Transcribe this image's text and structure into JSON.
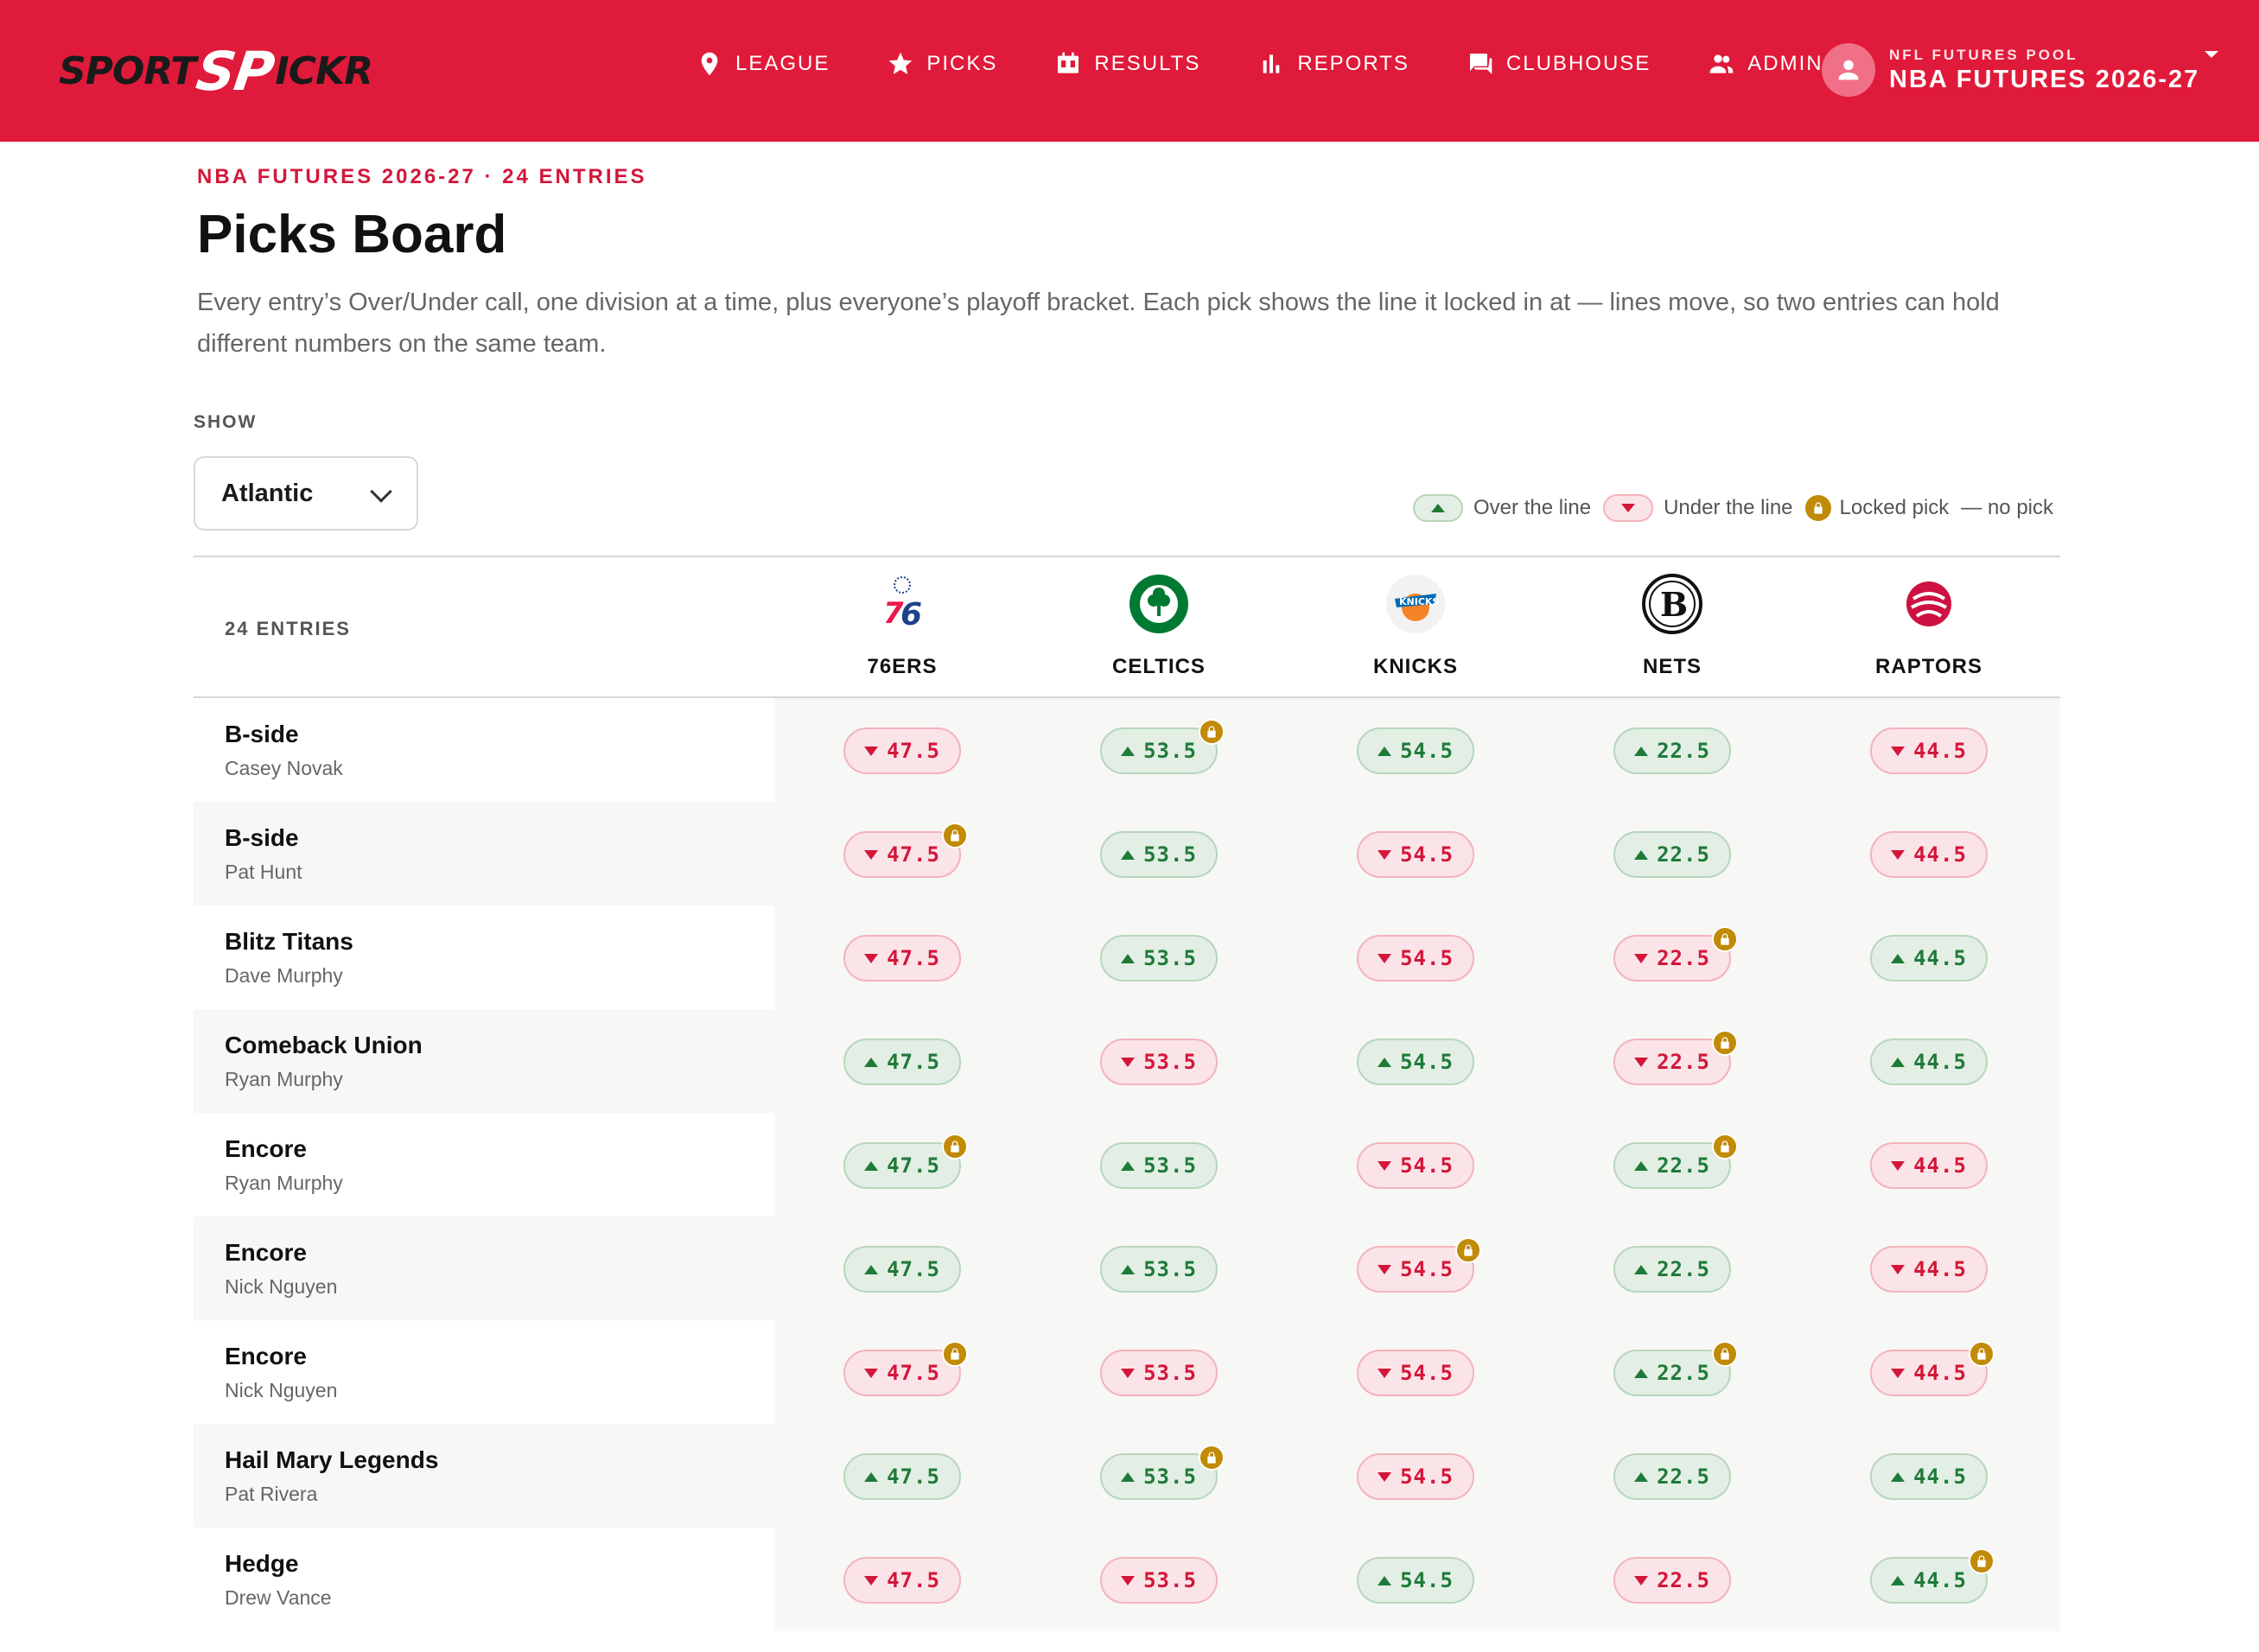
{
  "brand": {
    "logo_left": "SPORT",
    "logo_mid": "SP",
    "logo_right": "ICKR"
  },
  "nav": [
    {
      "label": "LEAGUE",
      "icon": "map-pin-icon"
    },
    {
      "label": "PICKS",
      "icon": "star-icon"
    },
    {
      "label": "RESULTS",
      "icon": "scoreboard-icon"
    },
    {
      "label": "REPORTS",
      "icon": "bar-chart-icon"
    },
    {
      "label": "CLUBHOUSE",
      "icon": "chat-icon"
    },
    {
      "label": "ADMIN",
      "icon": "people-icon"
    }
  ],
  "pool": {
    "label": "NFL FUTURES POOL",
    "value": "NBA FUTURES 2026-27"
  },
  "page": {
    "eyebrow": "NBA FUTURES 2026-27 · 24 ENTRIES",
    "title": "Picks Board",
    "description": "Every entry’s Over/Under call, one division at a time, plus everyone’s playoff bracket. Each pick shows the line it locked in at — lines move, so two entries can hold different numbers on the same team."
  },
  "filter": {
    "label": "SHOW",
    "selected": "Atlantic"
  },
  "legend": {
    "over": "Over the line",
    "under": "Under the line",
    "locked": "Locked pick",
    "nopick": "— no pick"
  },
  "table": {
    "entries_label": "24 ENTRIES",
    "teams": [
      "76ERS",
      "CELTICS",
      "KNICKS",
      "NETS",
      "RAPTORS"
    ],
    "rows": [
      {
        "entry": "B-side",
        "owner": "Casey Novak",
        "picks": [
          {
            "dir": "down",
            "line": "47.5",
            "lock": false
          },
          {
            "dir": "up",
            "line": "53.5",
            "lock": true
          },
          {
            "dir": "up",
            "line": "54.5",
            "lock": false
          },
          {
            "dir": "up",
            "line": "22.5",
            "lock": false
          },
          {
            "dir": "down",
            "line": "44.5",
            "lock": false
          }
        ]
      },
      {
        "entry": "B-side",
        "owner": "Pat Hunt",
        "picks": [
          {
            "dir": "down",
            "line": "47.5",
            "lock": true
          },
          {
            "dir": "up",
            "line": "53.5",
            "lock": false
          },
          {
            "dir": "down",
            "line": "54.5",
            "lock": false
          },
          {
            "dir": "up",
            "line": "22.5",
            "lock": false
          },
          {
            "dir": "down",
            "line": "44.5",
            "lock": false
          }
        ]
      },
      {
        "entry": "Blitz Titans",
        "owner": "Dave Murphy",
        "picks": [
          {
            "dir": "down",
            "line": "47.5",
            "lock": false
          },
          {
            "dir": "up",
            "line": "53.5",
            "lock": false
          },
          {
            "dir": "down",
            "line": "54.5",
            "lock": false
          },
          {
            "dir": "down",
            "line": "22.5",
            "lock": true
          },
          {
            "dir": "up",
            "line": "44.5",
            "lock": false
          }
        ]
      },
      {
        "entry": "Comeback Union",
        "owner": "Ryan Murphy",
        "picks": [
          {
            "dir": "up",
            "line": "47.5",
            "lock": false
          },
          {
            "dir": "down",
            "line": "53.5",
            "lock": false
          },
          {
            "dir": "up",
            "line": "54.5",
            "lock": false
          },
          {
            "dir": "down",
            "line": "22.5",
            "lock": true
          },
          {
            "dir": "up",
            "line": "44.5",
            "lock": false
          }
        ]
      },
      {
        "entry": "Encore",
        "owner": "Ryan Murphy",
        "picks": [
          {
            "dir": "up",
            "line": "47.5",
            "lock": true
          },
          {
            "dir": "up",
            "line": "53.5",
            "lock": false
          },
          {
            "dir": "down",
            "line": "54.5",
            "lock": false
          },
          {
            "dir": "up",
            "line": "22.5",
            "lock": true
          },
          {
            "dir": "down",
            "line": "44.5",
            "lock": false
          }
        ]
      },
      {
        "entry": "Encore",
        "owner": "Nick Nguyen",
        "picks": [
          {
            "dir": "up",
            "line": "47.5",
            "lock": false
          },
          {
            "dir": "up",
            "line": "53.5",
            "lock": false
          },
          {
            "dir": "down",
            "line": "54.5",
            "lock": true
          },
          {
            "dir": "up",
            "line": "22.5",
            "lock": false
          },
          {
            "dir": "down",
            "line": "44.5",
            "lock": false
          }
        ]
      },
      {
        "entry": "Encore",
        "owner": "Nick Nguyen",
        "picks": [
          {
            "dir": "down",
            "line": "47.5",
            "lock": true
          },
          {
            "dir": "down",
            "line": "53.5",
            "lock": false
          },
          {
            "dir": "down",
            "line": "54.5",
            "lock": false
          },
          {
            "dir": "up",
            "line": "22.5",
            "lock": true
          },
          {
            "dir": "down",
            "line": "44.5",
            "lock": true
          }
        ]
      },
      {
        "entry": "Hail Mary Legends",
        "owner": "Pat Rivera",
        "picks": [
          {
            "dir": "up",
            "line": "47.5",
            "lock": false
          },
          {
            "dir": "up",
            "line": "53.5",
            "lock": true
          },
          {
            "dir": "down",
            "line": "54.5",
            "lock": false
          },
          {
            "dir": "up",
            "line": "22.5",
            "lock": false
          },
          {
            "dir": "up",
            "line": "44.5",
            "lock": false
          }
        ]
      },
      {
        "entry": "Hedge",
        "owner": "Drew Vance",
        "picks": [
          {
            "dir": "down",
            "line": "47.5",
            "lock": false
          },
          {
            "dir": "down",
            "line": "53.5",
            "lock": false
          },
          {
            "dir": "up",
            "line": "54.5",
            "lock": false
          },
          {
            "dir": "down",
            "line": "22.5",
            "lock": false
          },
          {
            "dir": "up",
            "line": "44.5",
            "lock": true
          }
        ]
      }
    ]
  },
  "colors": {
    "brand_red": "#e01a3a",
    "over_green": "#1f7a3a",
    "under_red": "#d3163a",
    "lock_gold": "#c18a07"
  }
}
